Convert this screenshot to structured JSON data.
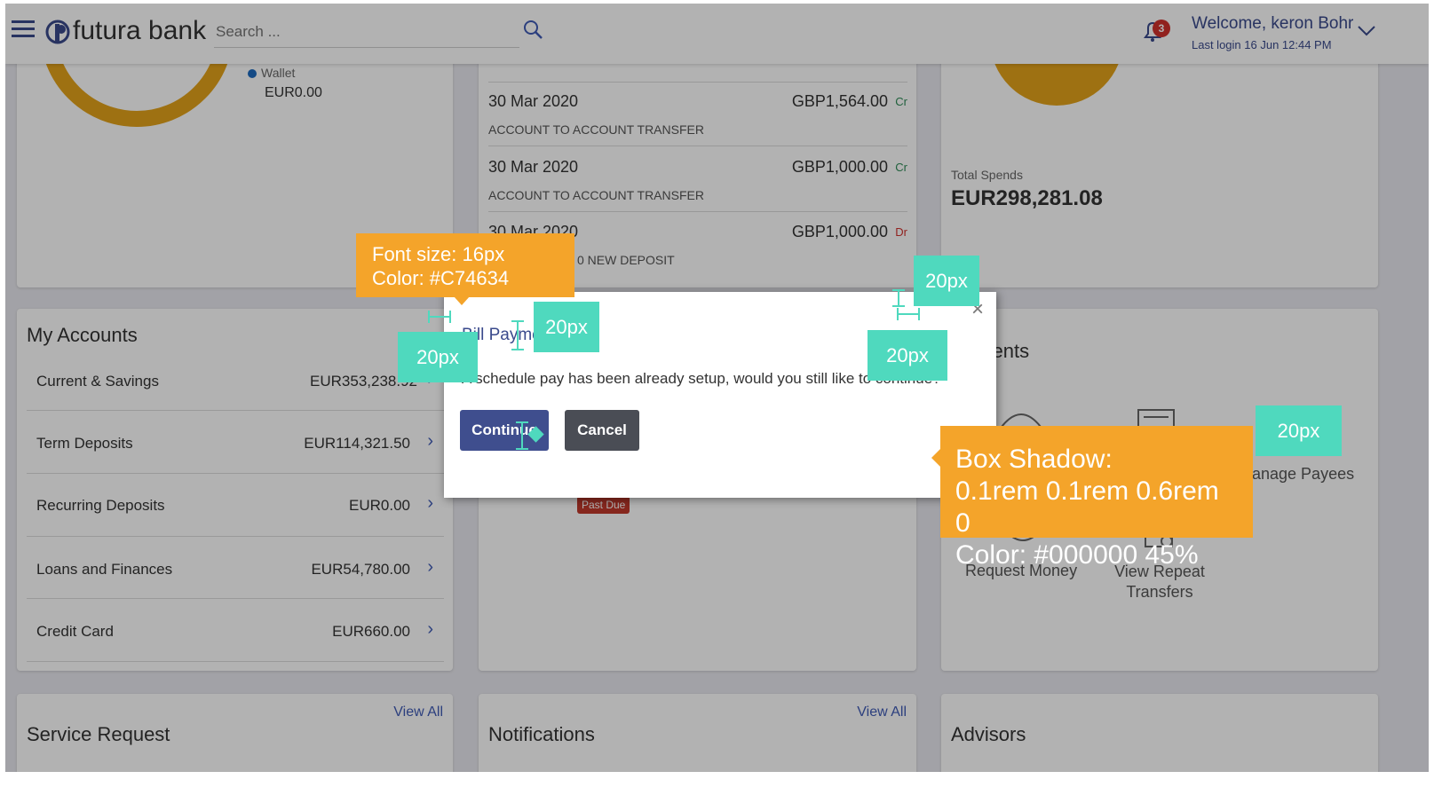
{
  "header": {
    "brand": "futura bank",
    "search_placeholder": "Search ...",
    "notification_count": "3",
    "welcome": "Welcome, keron Bohr",
    "last_login": "Last login 16 Jun 12:44 PM"
  },
  "wallet": {
    "label": "Wallet",
    "amount": "EUR0.00"
  },
  "transactions": [
    {
      "date": "30 Mar 2020",
      "desc": "ACCOUNT TO ACCOUNT TRANSFER",
      "amount": "GBP1,564.00",
      "type": "Cr"
    },
    {
      "date": "30 Mar 2020",
      "desc": "ACCOUNT TO ACCOUNT TRANSFER",
      "amount": "GBP1,000.00",
      "type": "Cr"
    },
    {
      "date": "30 Mar 2020",
      "desc": "0 NEW DEPOSIT",
      "amount": "GBP1,000.00",
      "type": "Dr"
    }
  ],
  "spends": {
    "label": "Total Spends",
    "amount": "EUR298,281.08"
  },
  "my_accounts": {
    "title": "My Accounts",
    "rows": [
      {
        "label": "Current & Savings",
        "amount": "EUR353,238.92"
      },
      {
        "label": "Term Deposits",
        "amount": "EUR114,321.50"
      },
      {
        "label": "Recurring Deposits",
        "amount": "EUR0.00"
      },
      {
        "label": "Loans and Finances",
        "amount": "EUR54,780.00"
      },
      {
        "label": "Credit Card",
        "amount": "EUR660.00"
      }
    ]
  },
  "payments": {
    "title": "ayments",
    "items": [
      "anage Payees",
      "Request Money",
      "View Repeat\nTransfers"
    ]
  },
  "bills": {
    "past_due": "Past Due"
  },
  "service_request": {
    "title": "Service Request",
    "view_all": "View All"
  },
  "notifications": {
    "title": "Notifications",
    "view_all": "View All"
  },
  "advisors": {
    "title": "Advisors"
  },
  "modal": {
    "title": "Bill Payme",
    "message": "A schedule pay has been already setup, would you still like to continue?",
    "continue_label": "Continue",
    "cancel_label": "Cancel",
    "close_glyph": "×"
  },
  "annotations": {
    "font_callout_line1": "Font size: 16px",
    "font_callout_line2": "Color: #C74634",
    "shadow_line1": "Box Shadow:",
    "shadow_line2": "0.1rem 0.1rem 0.6rem 0",
    "shadow_line3": "Color: #000000 45%",
    "spacing": "20px"
  },
  "colors": {
    "brand_blue": "#3f5bb5",
    "callout_orange": "#f4a42a",
    "measure_teal": "#4fd9be",
    "donut_gold": "#e3a21a",
    "cr_green": "#2e8b57",
    "dr_red": "#d0312d"
  }
}
